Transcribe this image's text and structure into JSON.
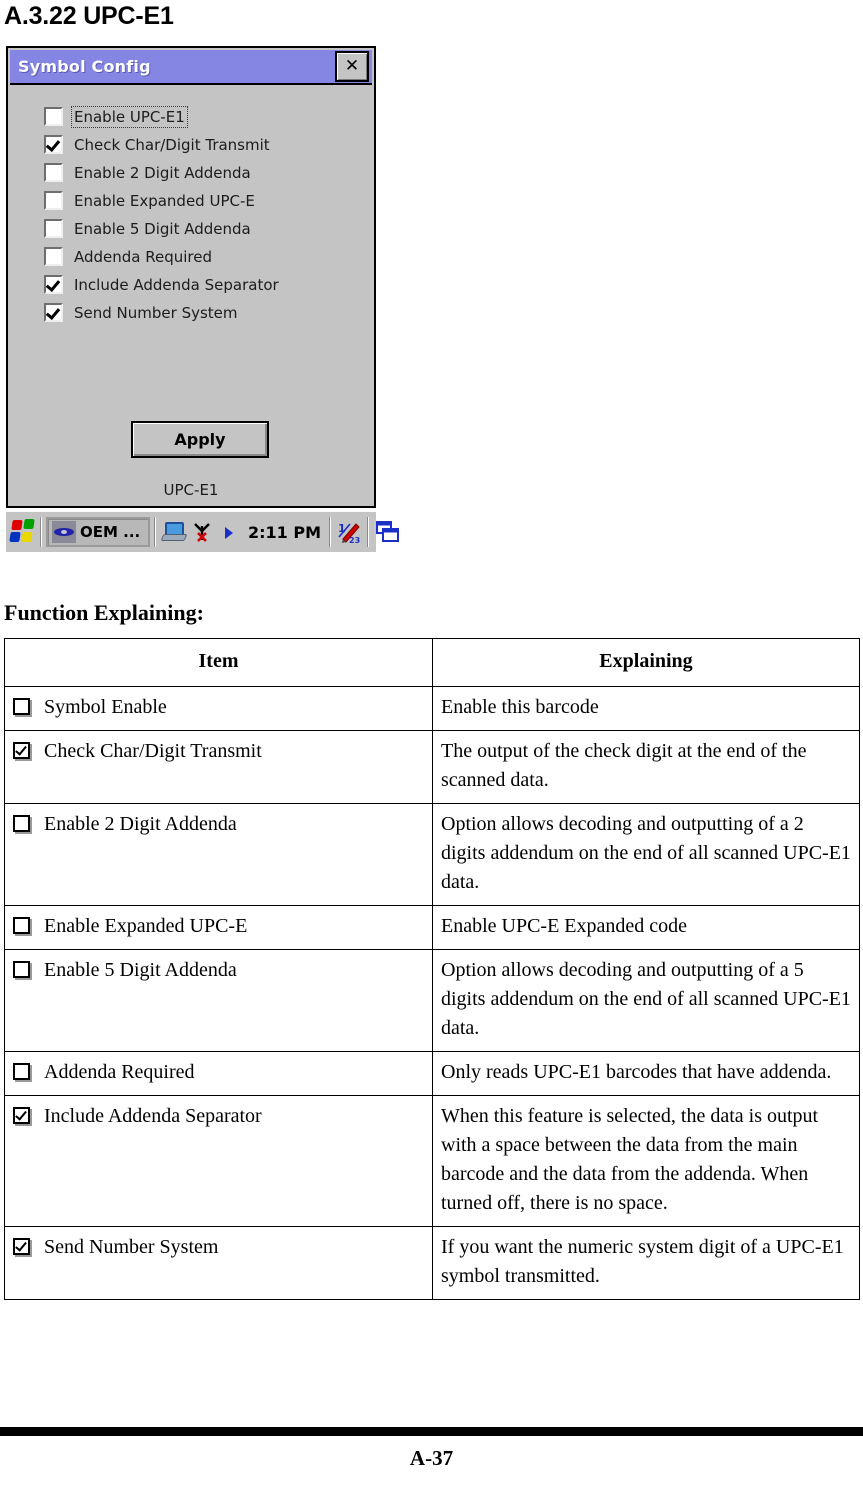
{
  "page": {
    "heading": "A.3.22 UPC-E1",
    "section_title": "Function Explaining:",
    "page_number": "A-37"
  },
  "dialog": {
    "title": "Symbol Config",
    "close_label": "✕",
    "apply_label": "Apply",
    "caption": "UPC-E1",
    "titlebar_color": "#8585e3",
    "face_color": "#c4c4c4",
    "checkboxes": [
      {
        "label": "Enable UPC-E1",
        "checked": false,
        "focused": true
      },
      {
        "label": "Check Char/Digit Transmit",
        "checked": true,
        "focused": false
      },
      {
        "label": "Enable 2 Digit Addenda",
        "checked": false,
        "focused": false
      },
      {
        "label": "Enable Expanded UPC-E",
        "checked": false,
        "focused": false
      },
      {
        "label": "Enable 5 Digit Addenda",
        "checked": false,
        "focused": false
      },
      {
        "label": "Addenda Required",
        "checked": false,
        "focused": false
      },
      {
        "label": "Include Addenda Separator",
        "checked": true,
        "focused": false
      },
      {
        "label": "Send Number System",
        "checked": true,
        "focused": false
      }
    ]
  },
  "taskbar": {
    "start_icon": "windows-ce-flag-icon",
    "task_button_label": "OEM ...",
    "task_button_icon": "oem-app-icon",
    "tray_icons": [
      "network-connection-icon",
      "antenna-disconnected-icon",
      "blue-arrow-icon"
    ],
    "clock": "2:11 PM",
    "right_icons": [
      "input-panel-icon",
      "window-switcher-icon"
    ]
  },
  "table": {
    "headers": [
      "Item",
      "Explaining"
    ],
    "rows": [
      {
        "checked": false,
        "item": "Symbol Enable",
        "explaining": "Enable this barcode"
      },
      {
        "checked": true,
        "item": "Check Char/Digit Transmit",
        "explaining": "The output of the check digit at the end of the scanned data."
      },
      {
        "checked": false,
        "item": "Enable 2 Digit Addenda",
        "explaining": "Option allows decoding and outputting of a 2 digits addendum on the end of all scanned UPC-E1 data."
      },
      {
        "checked": false,
        "item": "Enable Expanded UPC-E",
        "explaining": "Enable UPC-E Expanded code"
      },
      {
        "checked": false,
        "item": "Enable 5 Digit Addenda",
        "explaining": "Option allows decoding and outputting of a 5 digits addendum on the end of all scanned UPC-E1 data."
      },
      {
        "checked": false,
        "item": "Addenda Required",
        "explaining": "Only reads UPC-E1 barcodes that have addenda."
      },
      {
        "checked": true,
        "item": "Include Addenda Separator",
        "explaining": "When this feature is selected, the data is output with a space between the data from the main barcode and the data from the addenda. When turned off, there is no space."
      },
      {
        "checked": true,
        "item": "Send Number System",
        "explaining": "If you want the numeric system digit of a UPC-E1 symbol transmitted."
      }
    ]
  }
}
